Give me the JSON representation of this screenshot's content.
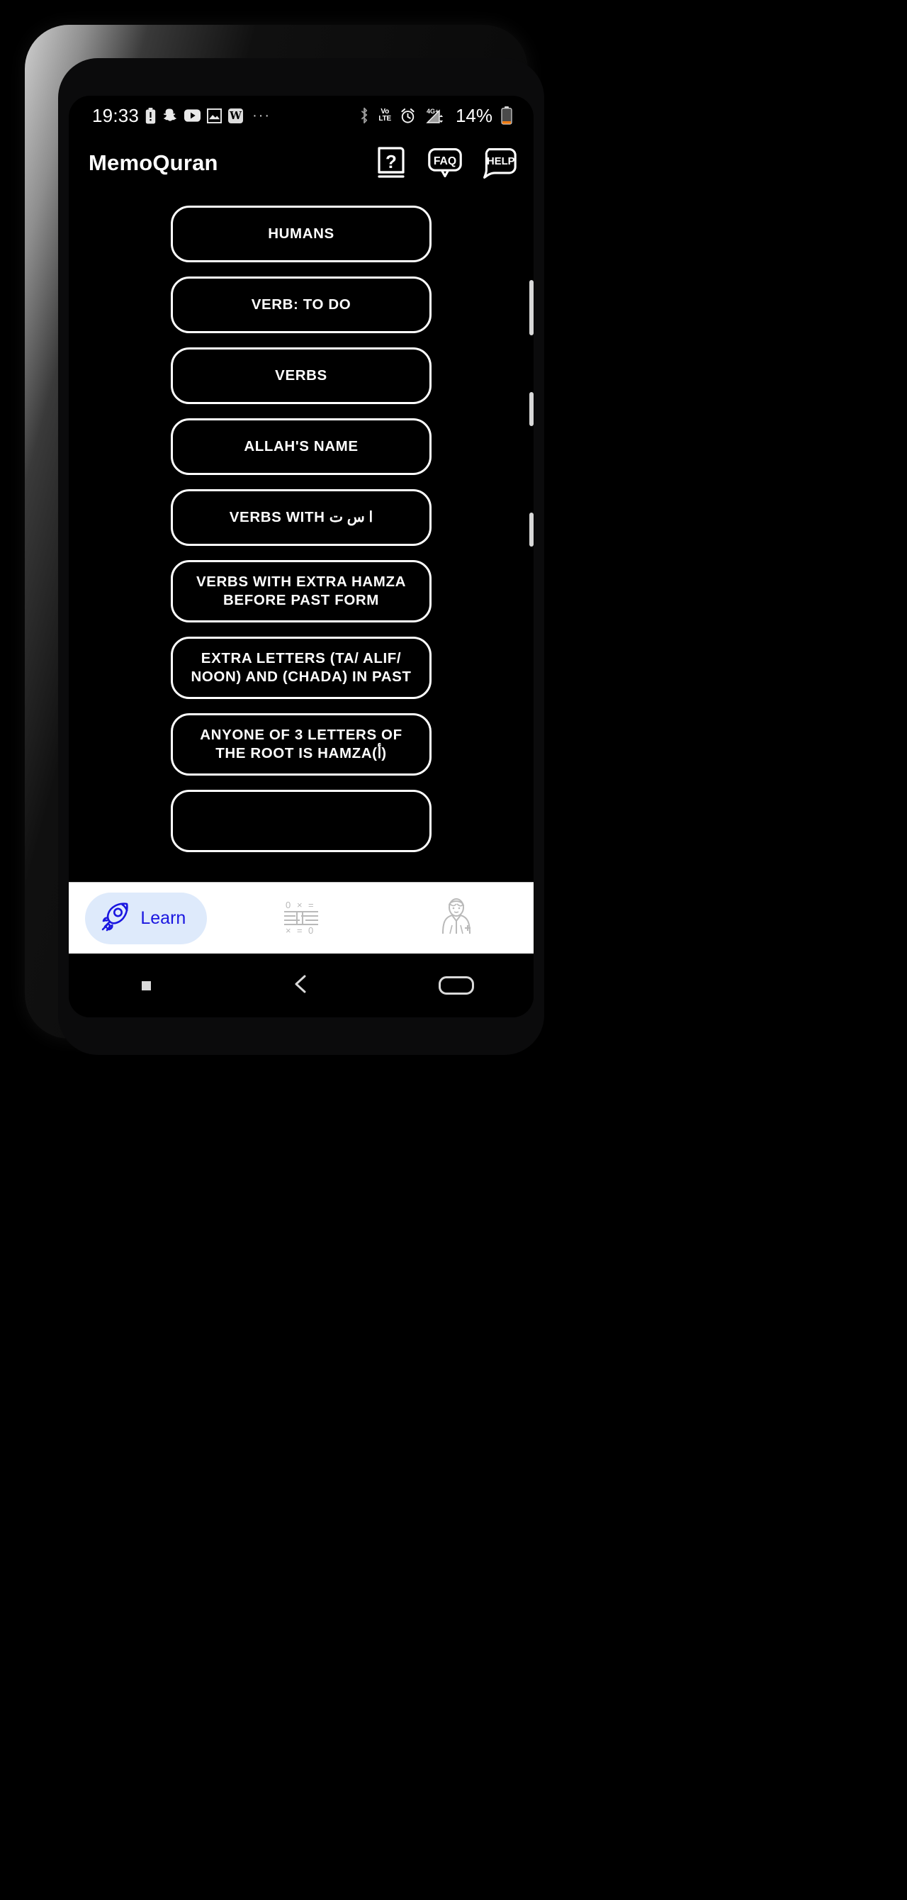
{
  "status_bar": {
    "time": "19:33",
    "left_icons": [
      "battery-alert-icon",
      "snapchat-icon",
      "youtube-icon",
      "gallery-icon",
      "w-app-icon"
    ],
    "w_label": "W",
    "overflow": "···",
    "right_icons": [
      "bluetooth-icon",
      "volte-icon",
      "alarm-icon",
      "signal-4g-plus-icon"
    ],
    "volte_line1": "Vo",
    "volte_line2": "LTE",
    "network": "4G+",
    "battery_percent": "14%"
  },
  "app_bar": {
    "title": "MemoQuran",
    "actions": [
      {
        "name": "manual-button",
        "label": "?"
      },
      {
        "name": "faq-button",
        "label": "FAQ"
      },
      {
        "name": "help-button",
        "label": "HELP"
      }
    ]
  },
  "list": {
    "items": [
      {
        "label": "HUMANS"
      },
      {
        "label": "VERB: TO DO"
      },
      {
        "label": "VERBS"
      },
      {
        "label": "ALLAH'S NAME"
      },
      {
        "label": "VERBS WITH ا س ت"
      },
      {
        "label": "VERBS WITH EXTRA HAMZA BEFORE PAST FORM"
      },
      {
        "label": "EXTRA LETTERS (TA/ ALIF/ NOON) AND (CHADA) IN PAST"
      },
      {
        "label": "ANYONE OF 3 LETTERS OF THE ROOT IS HAMZA(أ)"
      }
    ]
  },
  "bottom_nav": {
    "items": [
      {
        "name": "nav-learn",
        "label": "Learn",
        "icon": "rocket-icon",
        "active": true
      },
      {
        "name": "nav-practice",
        "label": "",
        "icon": "math-grid-icon",
        "active": false
      },
      {
        "name": "nav-teacher",
        "label": "",
        "icon": "teacher-icon",
        "active": false
      }
    ],
    "active_bg": "#deeafb",
    "active_color": "#1a16e0"
  },
  "android_nav": {
    "buttons": [
      "recent-apps-button",
      "back-button",
      "home-button"
    ]
  },
  "colors": {
    "screen_bg": "#000000",
    "outline": "#ffffff",
    "nav_bar_bg": "#ffffff",
    "battery_low": "#f07b12"
  }
}
